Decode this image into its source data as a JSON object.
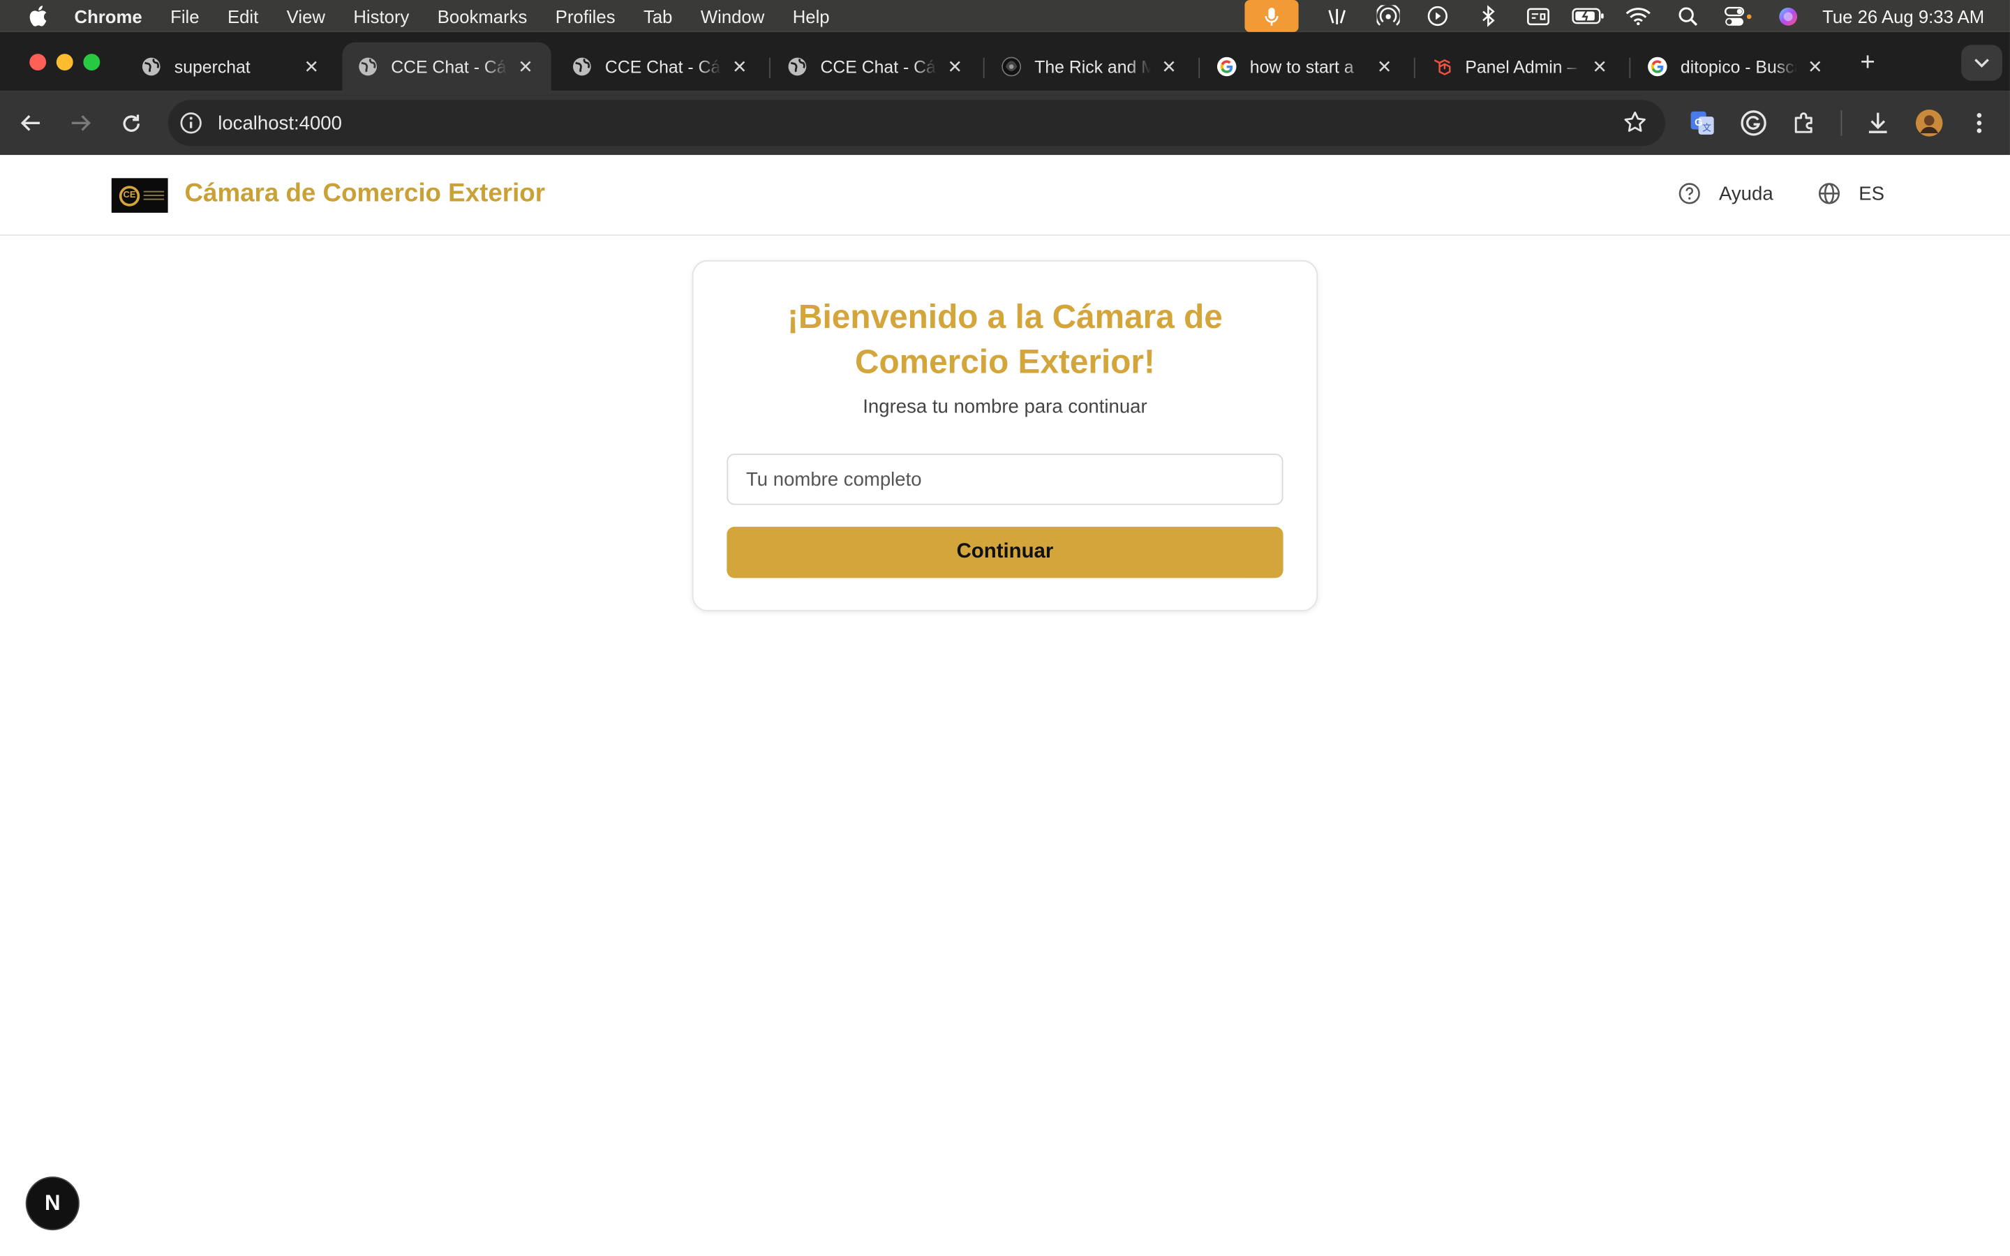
{
  "menubar": {
    "app_name": "Chrome",
    "items": [
      "File",
      "Edit",
      "View",
      "History",
      "Bookmarks",
      "Profiles",
      "Tab",
      "Window",
      "Help"
    ],
    "clock": "Tue 26 Aug  9:33 AM",
    "mic_color": "#f19a36"
  },
  "tabs": [
    {
      "title": "superchat",
      "favicon": "globe-icon",
      "active": false
    },
    {
      "title": "CCE Chat - Cámara de Comercio Exterior",
      "favicon": "globe-icon",
      "active": true
    },
    {
      "title": "CCE Chat - Cámara de Comercio Exterior",
      "favicon": "globe-icon",
      "active": false
    },
    {
      "title": "CCE Chat - Cámara de Comercio Exterior",
      "favicon": "globe-icon",
      "active": false
    },
    {
      "title": "The Rick and Morty",
      "favicon": "rick-morty-icon",
      "active": false
    },
    {
      "title": "how to start a",
      "favicon": "google-icon",
      "active": false
    },
    {
      "title": "Panel Admin – ",
      "favicon": "laravel-icon",
      "active": false
    },
    {
      "title": "ditopico - Buscar",
      "favicon": "google-icon",
      "active": false
    }
  ],
  "toolbar": {
    "url": "localhost:4000"
  },
  "site": {
    "title": "Cámara de Comercio Exterior",
    "logo_text": "CE",
    "help_label": "Ayuda",
    "lang_label": "ES",
    "accent_color": "#d4a53a"
  },
  "welcome": {
    "heading": "¡Bienvenido a la Cámara de Comercio Exterior!",
    "subtitle": "Ingresa tu nombre para continuar",
    "name_placeholder": "Tu nombre completo",
    "name_value": "",
    "continue_label": "Continuar"
  },
  "devtools_badge": "N"
}
